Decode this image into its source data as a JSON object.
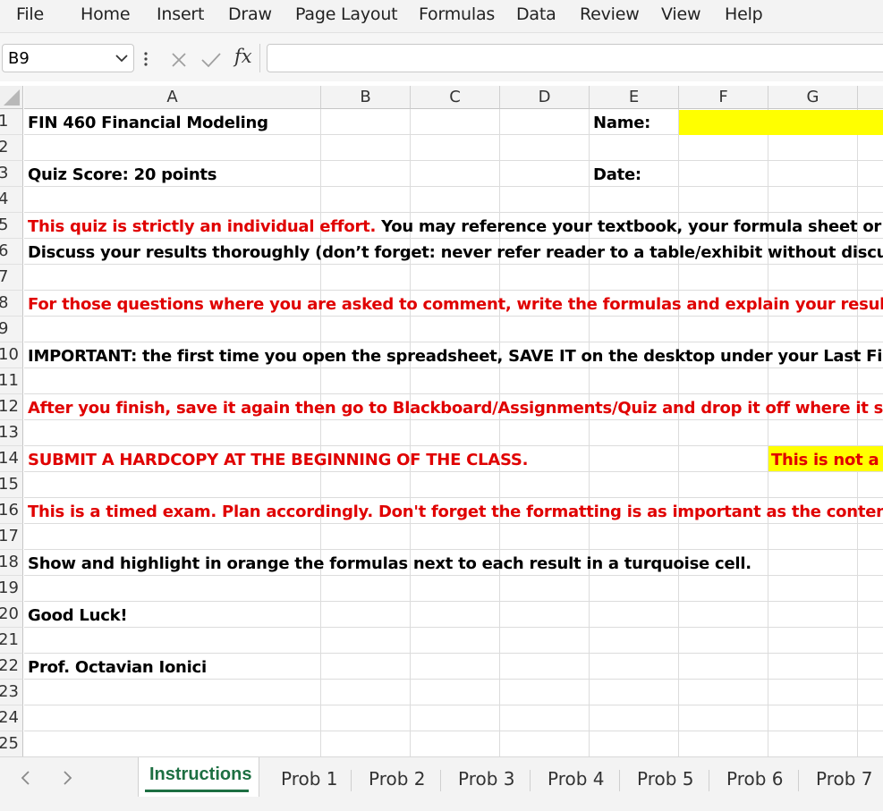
{
  "menu": [
    "File",
    "Home",
    "Insert",
    "Draw",
    "Page Layout",
    "Formulas",
    "Data",
    "Review",
    "View",
    "Help"
  ],
  "formula_bar": {
    "name_box": "B9",
    "fx": "fx",
    "formula": ""
  },
  "columns": [
    "A",
    "B",
    "C",
    "D",
    "E",
    "F",
    "G"
  ],
  "rows": [
    "1",
    "2",
    "3",
    "4",
    "5",
    "6",
    "7",
    "8",
    "9",
    "10",
    "11",
    "12",
    "13",
    "14",
    "15",
    "16",
    "17",
    "18",
    "19",
    "20",
    "21",
    "22",
    "23",
    "24",
    "25"
  ],
  "cells": {
    "a1": "FIN 460 Financial Modeling",
    "e1": "Name:",
    "a3": "Quiz Score: 20 points",
    "e3": "Date:",
    "a5_red": "This quiz is strictly an individual effort.",
    "a5_black": " You may reference your textbook, your formula sheet or other sp",
    "a6": "Discuss your results thoroughly (don’t forget: never refer reader to a table/exhibit without discussing it).",
    "a8": "For those questions where you are asked to comment, write the formulas and explain your results.",
    "a10": "IMPORTANT: the first time you open the spreadsheet, SAVE IT on the desktop under your Last First Nam",
    "a12": "After you finish, save it again then go to Blackboard/Assignments/Quiz and drop it off where it says “Sub",
    "a14": " SUBMIT A HARDCOPY AT THE BEGINNING OF THE CLASS.",
    "g14": "This is not a g",
    "a16": "This is a timed exam. Plan accordingly. Don't forget the formatting is as important as the content.",
    "a18": "Show and highlight in orange the formulas next to each result in a turquoise cell.",
    "a20": "Good Luck!",
    "a22": "Prof. Octavian Ionici"
  },
  "colors": {
    "highlight_yellow": "#ffff00",
    "text_red": "#e00000",
    "excel_green": "#1d6f42"
  },
  "sheet_tabs": [
    "Instructions",
    "Prob 1",
    "Prob 2",
    "Prob 3",
    "Prob 4",
    "Prob 5",
    "Prob 6",
    "Prob 7"
  ],
  "active_tab": "Instructions"
}
